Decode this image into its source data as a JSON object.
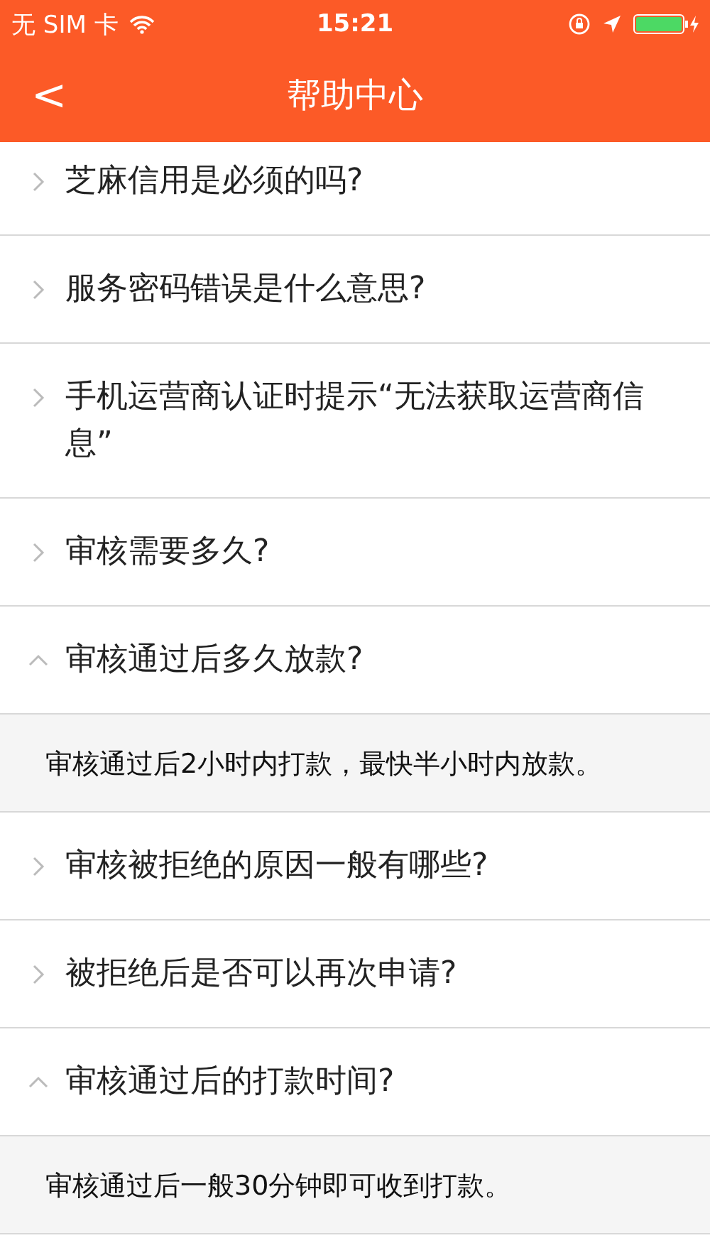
{
  "status_bar": {
    "carrier": "无 SIM 卡",
    "time": "15:21"
  },
  "nav": {
    "back": "<",
    "title": "帮助中心"
  },
  "faq": [
    {
      "question": "芝麻信用是必须的吗?",
      "expanded": false
    },
    {
      "question": "服务密码错误是什么意思?",
      "expanded": false
    },
    {
      "question": "手机运营商认证时提示“无法获取运营商信息”",
      "expanded": false
    },
    {
      "question": "审核需要多久?",
      "expanded": false
    },
    {
      "question": "审核通过后多久放款?",
      "expanded": true,
      "answer": "审核通过后2小时内打款，最快半小时内放款。"
    },
    {
      "question": "审核被拒绝的原因一般有哪些?",
      "expanded": false
    },
    {
      "question": "被拒绝后是否可以再次申请?",
      "expanded": false
    },
    {
      "question": "审核通过后的打款时间?",
      "expanded": true,
      "answer": "审核通过后一般30分钟即可收到打款。"
    }
  ]
}
